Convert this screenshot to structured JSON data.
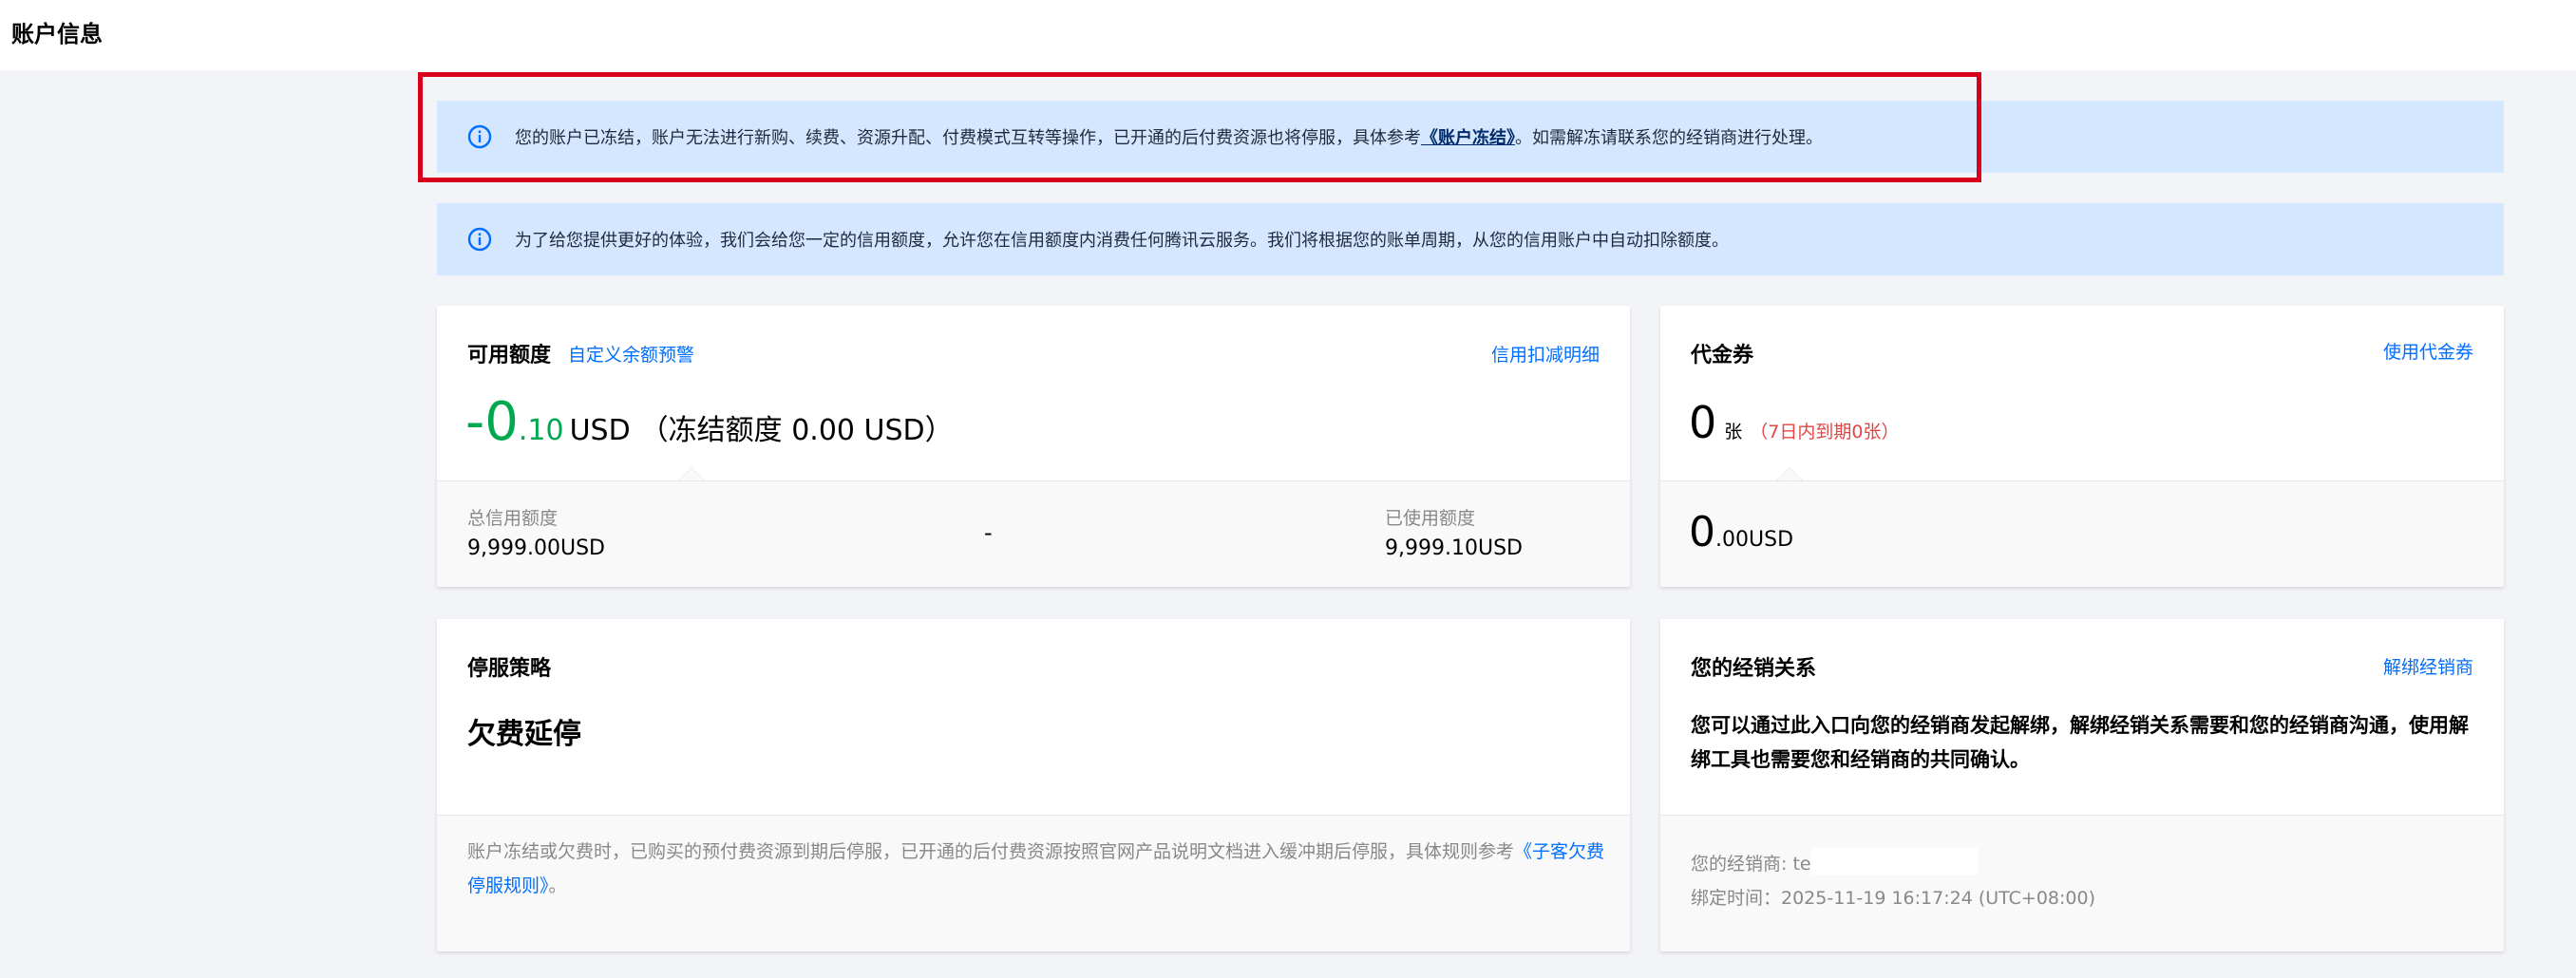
{
  "page": {
    "title": "账户信息"
  },
  "alerts": {
    "frozen": {
      "text_before": "您的账户已冻结，账户无法进行新购、续费、资源升配、付费模式互转等操作，已开通的后付费资源也将停服，具体参考",
      "link": "《账户冻结》",
      "text_after": "。如需解冻请联系您的经销商进行处理。",
      "icon": "info-circle-icon"
    },
    "credit": {
      "text": "为了给您提供更好的体验，我们会给您一定的信用额度，允许您在信用额度内消费任何腾讯云服务。我们将根据您的账单周期，从您的信用账户中自动扣除额度。",
      "icon": "info-circle-icon"
    }
  },
  "credit_card": {
    "title": "可用额度",
    "alert_link": "自定义余额预警",
    "detail_link": "信用扣减明细",
    "amount_int": "-0",
    "amount_dec": ".10",
    "currency": "USD",
    "frozen_text": "（冻结额度 0.00 USD）",
    "total_label": "总信用额度",
    "total_value": "9,999.00USD",
    "separator": "-",
    "used_label": "已使用额度",
    "used_value": "9,999.10USD"
  },
  "voucher_card": {
    "title": "代金券",
    "use_link": "使用代金券",
    "count": "0",
    "unit": "张",
    "expiring": "（7日内到期0张）",
    "amount_int": "0",
    "amount_dec": ".00",
    "currency": "USD"
  },
  "policy_card": {
    "title": "停服策略",
    "policy": "欠费延停",
    "desc_before": "账户冻结或欠费时，已购买的预付费资源到期后停服，已开通的后付费资源按照官网产品说明文档进入缓冲期后停服，具体规则参考",
    "desc_link": "《子客欠费停服规则》",
    "desc_after": "。"
  },
  "reseller_card": {
    "title": "您的经销关系",
    "unbind_link": "解绑经销商",
    "desc": "您可以通过此入口向您的经销商发起解绑，解绑经销关系需要和您的经销商沟通，使用解绑工具也需要您和经销商的共同确认。",
    "reseller_label": "您的经销商: te",
    "bind_time": "绑定时间：2025-11-19 16:17:24 (UTC+08:00)"
  },
  "colors": {
    "accent": "#006eff",
    "negative_amount": "#00a84f",
    "warning_text": "#e54545",
    "alert_bg": "#d5e7ff",
    "highlight_border": "#d9001b"
  }
}
